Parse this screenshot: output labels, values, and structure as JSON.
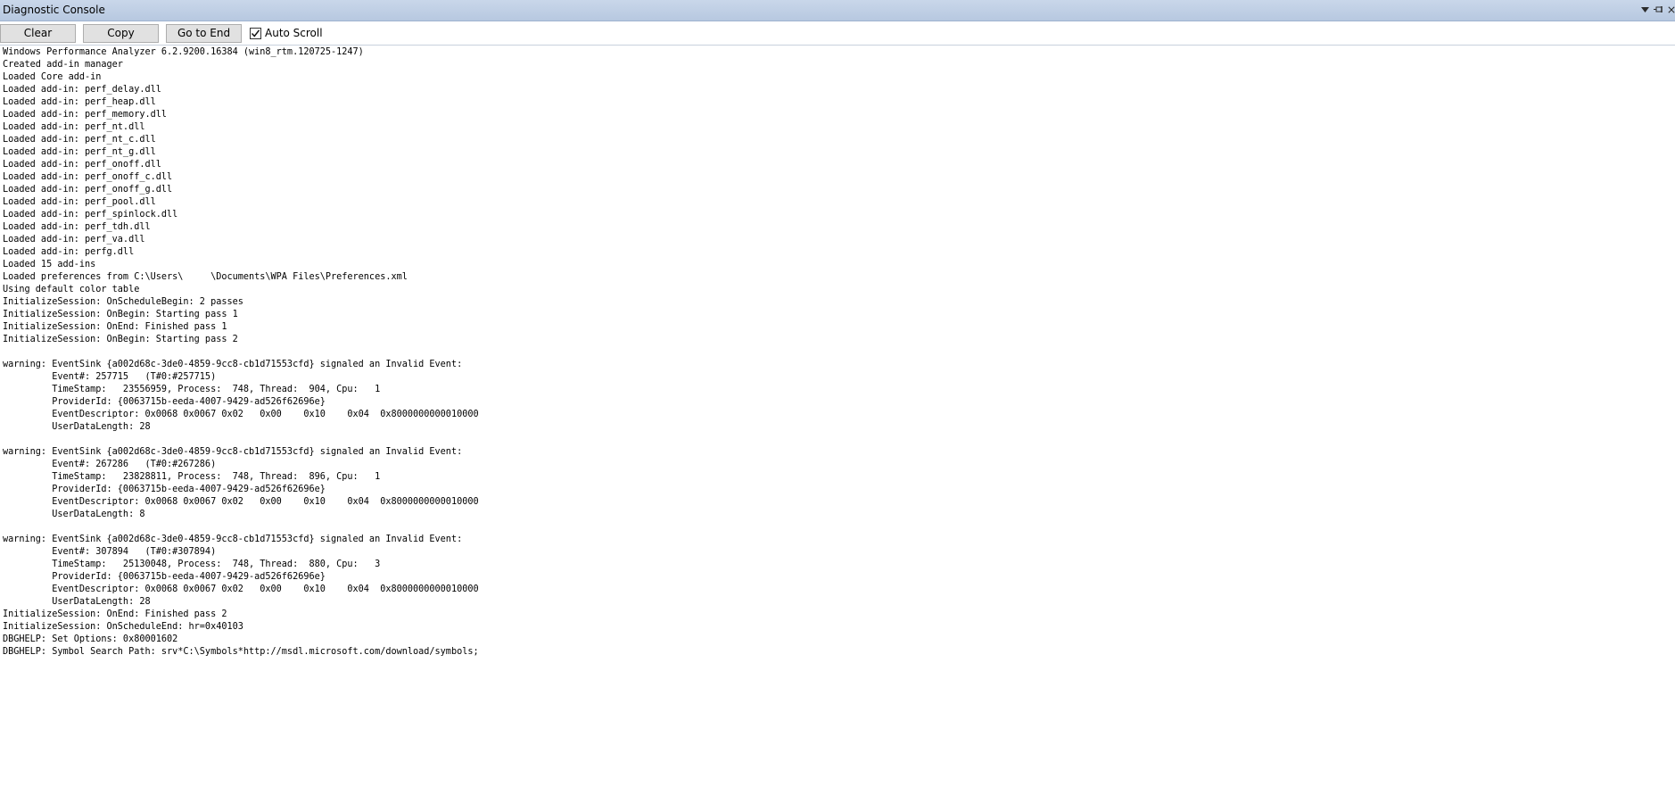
{
  "window": {
    "title": "Diagnostic Console"
  },
  "toolbar": {
    "clear_label": "Clear",
    "copy_label": "Copy",
    "goto_end_label": "Go to End",
    "autoscroll_label": "Auto Scroll",
    "autoscroll_checked": true
  },
  "console": {
    "lines": [
      "Windows Performance Analyzer 6.2.9200.16384 (win8_rtm.120725-1247)",
      "Created add-in manager",
      "Loaded Core add-in",
      "Loaded add-in: perf_delay.dll",
      "Loaded add-in: perf_heap.dll",
      "Loaded add-in: perf_memory.dll",
      "Loaded add-in: perf_nt.dll",
      "Loaded add-in: perf_nt_c.dll",
      "Loaded add-in: perf_nt_g.dll",
      "Loaded add-in: perf_onoff.dll",
      "Loaded add-in: perf_onoff_c.dll",
      "Loaded add-in: perf_onoff_g.dll",
      "Loaded add-in: perf_pool.dll",
      "Loaded add-in: perf_spinlock.dll",
      "Loaded add-in: perf_tdh.dll",
      "Loaded add-in: perf_va.dll",
      "Loaded add-in: perfg.dll",
      "Loaded 15 add-ins",
      "Loaded preferences from C:\\Users\\     \\Documents\\WPA Files\\Preferences.xml",
      "Using default color table",
      "InitializeSession: OnScheduleBegin: 2 passes",
      "InitializeSession: OnBegin: Starting pass 1",
      "InitializeSession: OnEnd: Finished pass 1",
      "InitializeSession: OnBegin: Starting pass 2",
      "",
      "warning: EventSink {a002d68c-3de0-4859-9cc8-cb1d71553cfd} signaled an Invalid Event:",
      "         Event#: 257715   (T#0:#257715)",
      "         TimeStamp:   23556959, Process:  748, Thread:  904, Cpu:   1",
      "         ProviderId: {0063715b-eeda-4007-9429-ad526f62696e}",
      "         EventDescriptor: 0x0068 0x0067 0x02   0x00    0x10    0x04  0x8000000000010000",
      "         UserDataLength: 28",
      "",
      "warning: EventSink {a002d68c-3de0-4859-9cc8-cb1d71553cfd} signaled an Invalid Event:",
      "         Event#: 267286   (T#0:#267286)",
      "         TimeStamp:   23828811, Process:  748, Thread:  896, Cpu:   1",
      "         ProviderId: {0063715b-eeda-4007-9429-ad526f62696e}",
      "         EventDescriptor: 0x0068 0x0067 0x02   0x00    0x10    0x04  0x8000000000010000",
      "         UserDataLength: 8",
      "",
      "warning: EventSink {a002d68c-3de0-4859-9cc8-cb1d71553cfd} signaled an Invalid Event:",
      "         Event#: 307894   (T#0:#307894)",
      "         TimeStamp:   25130048, Process:  748, Thread:  880, Cpu:   3",
      "         ProviderId: {0063715b-eeda-4007-9429-ad526f62696e}",
      "         EventDescriptor: 0x0068 0x0067 0x02   0x00    0x10    0x04  0x8000000000010000",
      "         UserDataLength: 28",
      "InitializeSession: OnEnd: Finished pass 2",
      "InitializeSession: OnScheduleEnd: hr=0x40103",
      "DBGHELP: Set Options: 0x80001602",
      "DBGHELP: Symbol Search Path: srv*C:\\Symbols*http://msdl.microsoft.com/download/symbols;"
    ]
  },
  "icons": {
    "dropdown": "chevron-down-icon",
    "pin": "pin-icon",
    "close": "close-icon"
  }
}
